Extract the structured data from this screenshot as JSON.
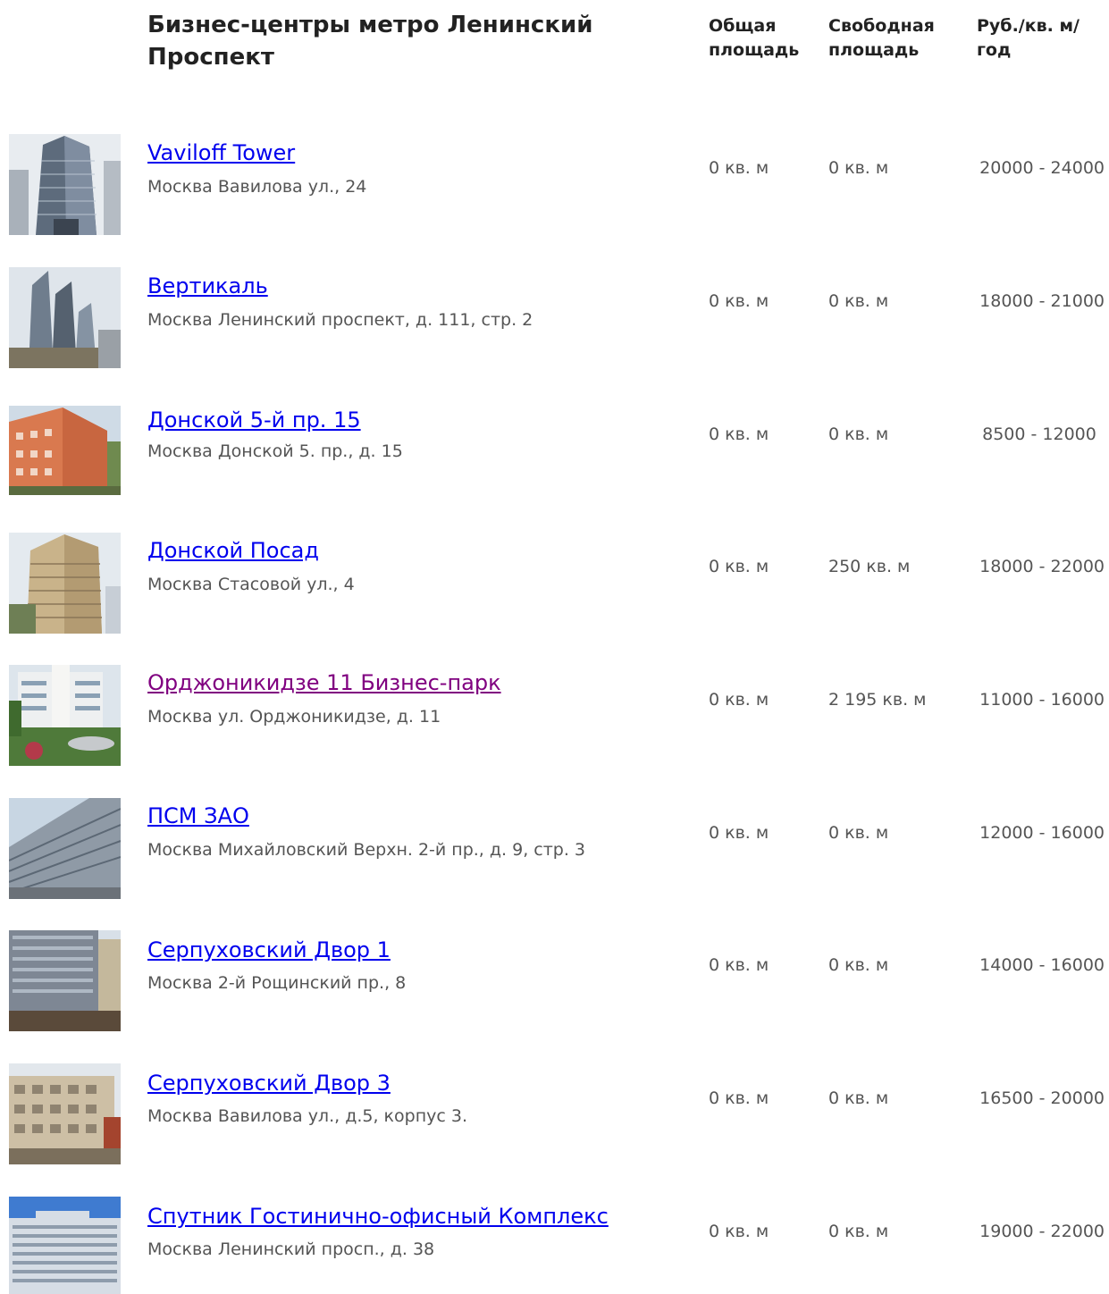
{
  "header": {
    "title": "Бизнес-центры метро Ленинский Проспект",
    "col_total": "Общая площадь",
    "col_free": "Свободная площадь",
    "col_price": "Руб./кв. м/год"
  },
  "colors": {
    "link": "#0000ee",
    "visited_link": "#800080",
    "text": "#555555",
    "heading": "#222222"
  },
  "rows": [
    {
      "name": "Vaviloff Tower",
      "address": "Москва Вавилова ул., 24",
      "total": "0 кв. м",
      "free": "0 кв. м",
      "price": "20000 - 24000",
      "visited": false,
      "image": "glass-tower-photo"
    },
    {
      "name": "Вертикаль",
      "address": "Москва Ленинский проспект, д. 111, стр. 2",
      "total": "0 кв. м",
      "free": "0 кв. м",
      "price": "18000 - 21000",
      "visited": false,
      "image": "twin-towers-photo"
    },
    {
      "name": "Донской 5-й пр. 15",
      "address": "Москва Донской 5. пр., д. 15",
      "total": "0 кв. м",
      "free": "0 кв. м",
      "price": "8500 - 12000",
      "visited": false,
      "image": "orange-building-photo"
    },
    {
      "name": "Донской Посад",
      "address": "Москва Стасовой ул., 4",
      "total": "0 кв. м",
      "free": "250 кв. м",
      "price": "18000 - 22000",
      "visited": false,
      "image": "highrise-photo"
    },
    {
      "name": "Орджоникидзе 11 Бизнес-парк",
      "address": "Москва ул. Орджоникидзе, д. 11",
      "total": "0 кв. м",
      "free": "2 195 кв. м",
      "price": "11000 - 16000",
      "visited": true,
      "image": "business-park-photo"
    },
    {
      "name": "ПСМ ЗАО",
      "address": "Москва Михайловский Верхн. 2-й пр., д. 9, стр. 3",
      "total": "0 кв. м",
      "free": "0 кв. м",
      "price": "12000 - 16000",
      "visited": false,
      "image": "grey-building-photo"
    },
    {
      "name": "Серпуховский Двор 1",
      "address": "Москва 2-й Рощинский пр., 8",
      "total": "0 кв. м",
      "free": "0 кв. м",
      "price": "14000 - 16000",
      "visited": false,
      "image": "office-block-photo"
    },
    {
      "name": "Серпуховский Двор 3",
      "address": "Москва Вавилова ул., д.5, корпус 3.",
      "total": "0 кв. м",
      "free": "0 кв. м",
      "price": "16500 - 20000",
      "visited": false,
      "image": "beige-building-photo"
    },
    {
      "name": "Спутник Гостинично-офисный Комплекс",
      "address": "Москва Ленинский просп., д. 38",
      "total": "0 кв. м",
      "free": "0 кв. м",
      "price": "19000 - 22000",
      "visited": false,
      "image": "hotel-complex-photo"
    }
  ]
}
